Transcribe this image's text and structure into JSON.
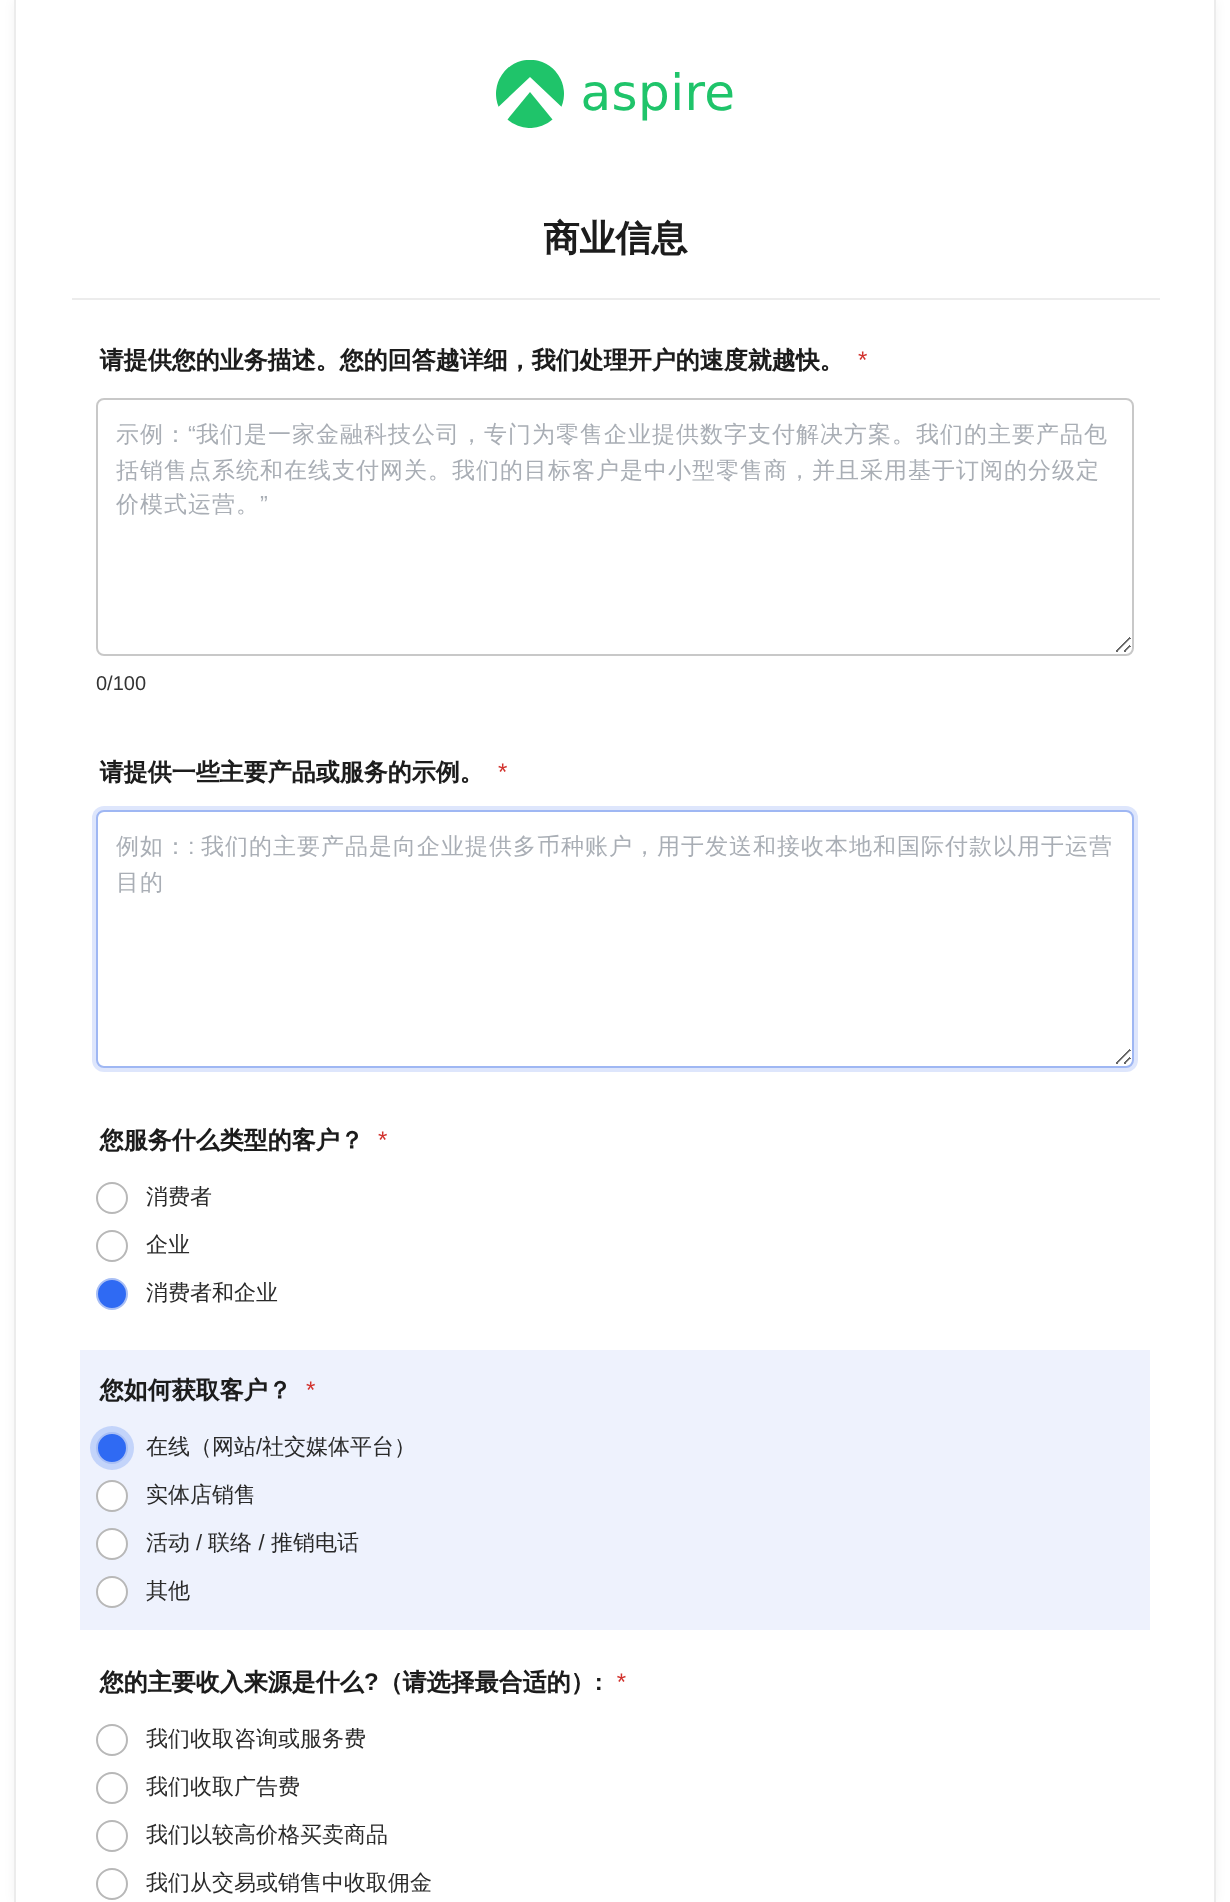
{
  "logo": {
    "text": "aspire"
  },
  "title": "商业信息",
  "questions": [
    {
      "kind": "textarea",
      "label": "请提供您的业务描述。您的回答越详细，我们处理开户的速度就越快。",
      "mark": "*",
      "placeholder": "示例：“我们是一家金融科技公司，专门为零售企业提供数字支付解决方案。我们的主要产品包括销售点系统和在线支付网关。我们的目标客户是中小型零售商，并且采用基于订阅的分级定价模式运营。”",
      "focused": false,
      "counter": "0/100"
    },
    {
      "kind": "textarea",
      "label": "请提供一些主要产品或服务的示例。",
      "mark": "*",
      "placeholder": "例如：: 我们的主要产品是向企业提供多币种账户，用于发送和接收本地和国际付款以用于运营目的",
      "focused": true
    },
    {
      "kind": "radio",
      "label": "您服务什么类型的客户？",
      "mark": "*",
      "active": false,
      "options": [
        {
          "label": "消费者",
          "selected": false
        },
        {
          "label": "企业",
          "selected": false
        },
        {
          "label": "消费者和企业",
          "selected": true
        }
      ]
    },
    {
      "kind": "radio",
      "label": "您如何获取客户？",
      "mark": "*",
      "active": true,
      "options": [
        {
          "label": "在线（网站/社交媒体平台）",
          "selected": true
        },
        {
          "label": "实体店销售",
          "selected": false
        },
        {
          "label": "活动 / 联络 / 推销电话",
          "selected": false
        },
        {
          "label": "其他",
          "selected": false
        }
      ]
    },
    {
      "kind": "radio",
      "label": "您的主要收入来源是什么?（请选择最合适的）:",
      "mark": "*",
      "active": false,
      "options": [
        {
          "label": "我们收取咨询或服务费",
          "selected": false
        },
        {
          "label": "我们收取广告费",
          "selected": false
        },
        {
          "label": "我们以较高价格买卖商品",
          "selected": false
        },
        {
          "label": "我们从交易或销售中收取佣金",
          "selected": false
        }
      ]
    }
  ]
}
